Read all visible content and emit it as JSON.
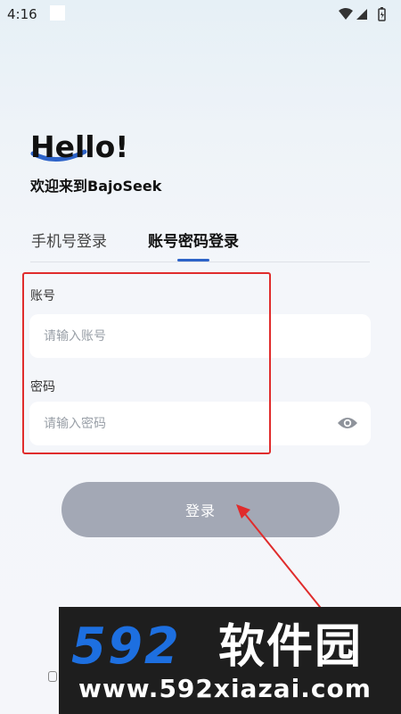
{
  "status_bar": {
    "time": "4:16"
  },
  "greeting": {
    "hello": "Hello!",
    "welcome": "欢迎来到BajoSeek"
  },
  "tabs": [
    {
      "label": "手机号登录",
      "active": false
    },
    {
      "label": "账号密码登录",
      "active": true
    }
  ],
  "form": {
    "account_label": "账号",
    "account_placeholder": "请输入账号",
    "account_value": "",
    "password_label": "密码",
    "password_placeholder": "请输入密码",
    "password_value": ""
  },
  "login_button": {
    "label": "登录"
  },
  "watermark": {
    "logo_number": "592",
    "logo_text": "软件园",
    "url": "www.592xiazai.com"
  },
  "colors": {
    "tab_indicator": "#2d63c8",
    "login_button_bg": "#a3a8b5",
    "annotation_red": "#e02c2c",
    "watermark_blue": "#1d6fe0"
  },
  "icons": {
    "wifi": "wifi-icon",
    "signal": "signal-icon",
    "battery": "battery-icon",
    "password_toggle": "eye-icon"
  }
}
